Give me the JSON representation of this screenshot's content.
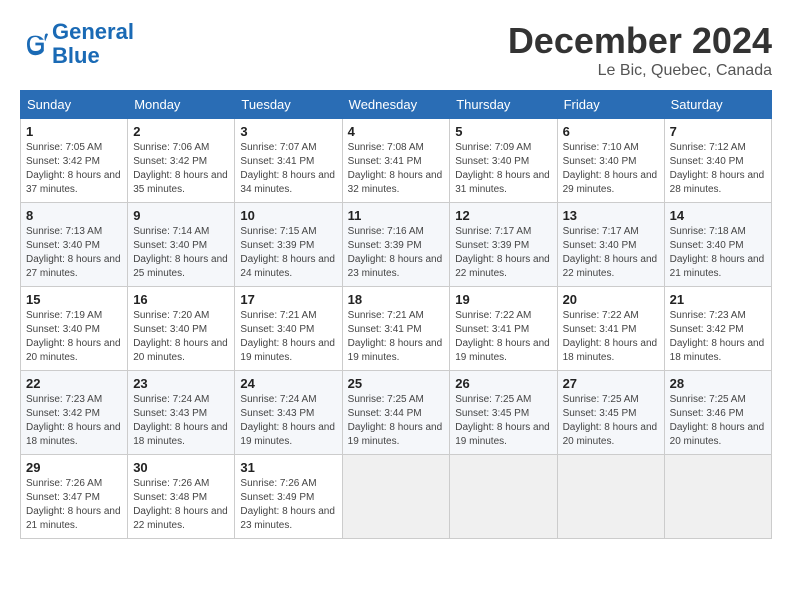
{
  "header": {
    "logo_general": "General",
    "logo_blue": "Blue",
    "title": "December 2024",
    "subtitle": "Le Bic, Quebec, Canada"
  },
  "days_of_week": [
    "Sunday",
    "Monday",
    "Tuesday",
    "Wednesday",
    "Thursday",
    "Friday",
    "Saturday"
  ],
  "weeks": [
    [
      {
        "day": "1",
        "sunrise": "Sunrise: 7:05 AM",
        "sunset": "Sunset: 3:42 PM",
        "daylight": "Daylight: 8 hours and 37 minutes."
      },
      {
        "day": "2",
        "sunrise": "Sunrise: 7:06 AM",
        "sunset": "Sunset: 3:42 PM",
        "daylight": "Daylight: 8 hours and 35 minutes."
      },
      {
        "day": "3",
        "sunrise": "Sunrise: 7:07 AM",
        "sunset": "Sunset: 3:41 PM",
        "daylight": "Daylight: 8 hours and 34 minutes."
      },
      {
        "day": "4",
        "sunrise": "Sunrise: 7:08 AM",
        "sunset": "Sunset: 3:41 PM",
        "daylight": "Daylight: 8 hours and 32 minutes."
      },
      {
        "day": "5",
        "sunrise": "Sunrise: 7:09 AM",
        "sunset": "Sunset: 3:40 PM",
        "daylight": "Daylight: 8 hours and 31 minutes."
      },
      {
        "day": "6",
        "sunrise": "Sunrise: 7:10 AM",
        "sunset": "Sunset: 3:40 PM",
        "daylight": "Daylight: 8 hours and 29 minutes."
      },
      {
        "day": "7",
        "sunrise": "Sunrise: 7:12 AM",
        "sunset": "Sunset: 3:40 PM",
        "daylight": "Daylight: 8 hours and 28 minutes."
      }
    ],
    [
      {
        "day": "8",
        "sunrise": "Sunrise: 7:13 AM",
        "sunset": "Sunset: 3:40 PM",
        "daylight": "Daylight: 8 hours and 27 minutes."
      },
      {
        "day": "9",
        "sunrise": "Sunrise: 7:14 AM",
        "sunset": "Sunset: 3:40 PM",
        "daylight": "Daylight: 8 hours and 25 minutes."
      },
      {
        "day": "10",
        "sunrise": "Sunrise: 7:15 AM",
        "sunset": "Sunset: 3:39 PM",
        "daylight": "Daylight: 8 hours and 24 minutes."
      },
      {
        "day": "11",
        "sunrise": "Sunrise: 7:16 AM",
        "sunset": "Sunset: 3:39 PM",
        "daylight": "Daylight: 8 hours and 23 minutes."
      },
      {
        "day": "12",
        "sunrise": "Sunrise: 7:17 AM",
        "sunset": "Sunset: 3:39 PM",
        "daylight": "Daylight: 8 hours and 22 minutes."
      },
      {
        "day": "13",
        "sunrise": "Sunrise: 7:17 AM",
        "sunset": "Sunset: 3:40 PM",
        "daylight": "Daylight: 8 hours and 22 minutes."
      },
      {
        "day": "14",
        "sunrise": "Sunrise: 7:18 AM",
        "sunset": "Sunset: 3:40 PM",
        "daylight": "Daylight: 8 hours and 21 minutes."
      }
    ],
    [
      {
        "day": "15",
        "sunrise": "Sunrise: 7:19 AM",
        "sunset": "Sunset: 3:40 PM",
        "daylight": "Daylight: 8 hours and 20 minutes."
      },
      {
        "day": "16",
        "sunrise": "Sunrise: 7:20 AM",
        "sunset": "Sunset: 3:40 PM",
        "daylight": "Daylight: 8 hours and 20 minutes."
      },
      {
        "day": "17",
        "sunrise": "Sunrise: 7:21 AM",
        "sunset": "Sunset: 3:40 PM",
        "daylight": "Daylight: 8 hours and 19 minutes."
      },
      {
        "day": "18",
        "sunrise": "Sunrise: 7:21 AM",
        "sunset": "Sunset: 3:41 PM",
        "daylight": "Daylight: 8 hours and 19 minutes."
      },
      {
        "day": "19",
        "sunrise": "Sunrise: 7:22 AM",
        "sunset": "Sunset: 3:41 PM",
        "daylight": "Daylight: 8 hours and 19 minutes."
      },
      {
        "day": "20",
        "sunrise": "Sunrise: 7:22 AM",
        "sunset": "Sunset: 3:41 PM",
        "daylight": "Daylight: 8 hours and 18 minutes."
      },
      {
        "day": "21",
        "sunrise": "Sunrise: 7:23 AM",
        "sunset": "Sunset: 3:42 PM",
        "daylight": "Daylight: 8 hours and 18 minutes."
      }
    ],
    [
      {
        "day": "22",
        "sunrise": "Sunrise: 7:23 AM",
        "sunset": "Sunset: 3:42 PM",
        "daylight": "Daylight: 8 hours and 18 minutes."
      },
      {
        "day": "23",
        "sunrise": "Sunrise: 7:24 AM",
        "sunset": "Sunset: 3:43 PM",
        "daylight": "Daylight: 8 hours and 18 minutes."
      },
      {
        "day": "24",
        "sunrise": "Sunrise: 7:24 AM",
        "sunset": "Sunset: 3:43 PM",
        "daylight": "Daylight: 8 hours and 19 minutes."
      },
      {
        "day": "25",
        "sunrise": "Sunrise: 7:25 AM",
        "sunset": "Sunset: 3:44 PM",
        "daylight": "Daylight: 8 hours and 19 minutes."
      },
      {
        "day": "26",
        "sunrise": "Sunrise: 7:25 AM",
        "sunset": "Sunset: 3:45 PM",
        "daylight": "Daylight: 8 hours and 19 minutes."
      },
      {
        "day": "27",
        "sunrise": "Sunrise: 7:25 AM",
        "sunset": "Sunset: 3:45 PM",
        "daylight": "Daylight: 8 hours and 20 minutes."
      },
      {
        "day": "28",
        "sunrise": "Sunrise: 7:25 AM",
        "sunset": "Sunset: 3:46 PM",
        "daylight": "Daylight: 8 hours and 20 minutes."
      }
    ],
    [
      {
        "day": "29",
        "sunrise": "Sunrise: 7:26 AM",
        "sunset": "Sunset: 3:47 PM",
        "daylight": "Daylight: 8 hours and 21 minutes."
      },
      {
        "day": "30",
        "sunrise": "Sunrise: 7:26 AM",
        "sunset": "Sunset: 3:48 PM",
        "daylight": "Daylight: 8 hours and 22 minutes."
      },
      {
        "day": "31",
        "sunrise": "Sunrise: 7:26 AM",
        "sunset": "Sunset: 3:49 PM",
        "daylight": "Daylight: 8 hours and 23 minutes."
      },
      null,
      null,
      null,
      null
    ]
  ]
}
